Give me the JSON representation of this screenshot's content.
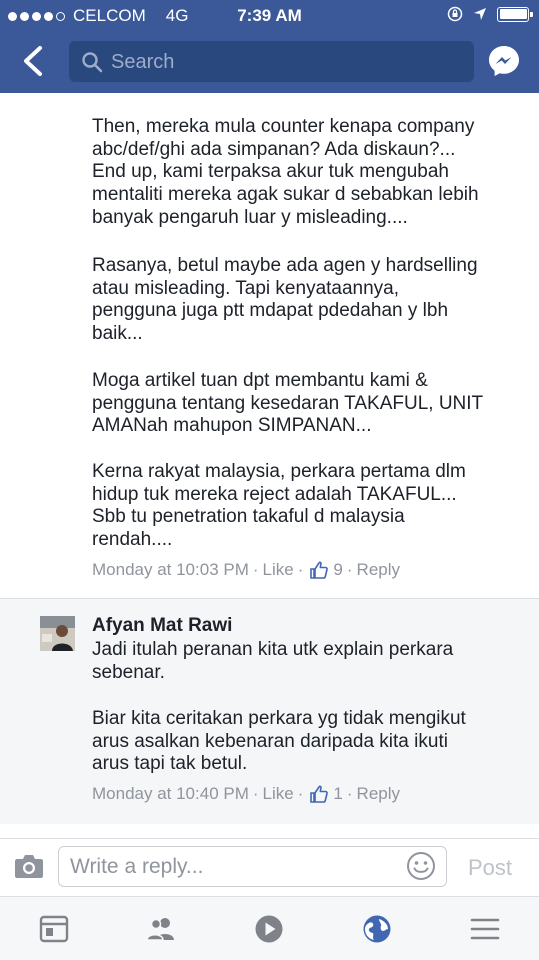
{
  "status_bar": {
    "carrier": "CELCOM",
    "network": "4G",
    "time": "7:39 AM"
  },
  "nav": {
    "search_placeholder": "Search"
  },
  "comments": [
    {
      "paragraphs": [
        "Then, mereka mula counter kenapa company\nabc/def/ghi ada simpanan? Ada diskaun?...\nEnd up, kami terpaksa akur tuk mengubah\nmentaliti mereka agak sukar d sebabkan lebih\nbanyak pengaruh luar y misleading....",
        "Rasanya, betul maybe ada agen y hardselling\natau misleading. Tapi kenyataannya,\npengguna juga ptt mdapat pdedahan y lbh\nbaik...",
        "Moga artikel tuan dpt membantu kami &\npengguna tentang kesedaran TAKAFUL, UNIT\nAMANah mahupon SIMPANAN...",
        "Kerna rakyat malaysia, perkara pertama dlm\nhidup tuk mereka reject adalah TAKAFUL...\nSbb tu penetration takaful d malaysia\nrendah...."
      ],
      "timestamp": "Monday at 10:03 PM",
      "like_label": "Like",
      "like_count": "9",
      "reply_label": "Reply"
    },
    {
      "author": "Afyan Mat Rawi",
      "paragraphs": [
        "Jadi itulah peranan kita utk explain perkara\nsebenar.",
        "Biar  kita ceritakan perkara yg tidak mengikut\narus asalkan kebenaran daripada kita ikuti\narus tapi tak betul."
      ],
      "timestamp": "Monday at 10:40 PM",
      "like_label": "Like",
      "like_count": "1",
      "reply_label": "Reply"
    }
  ],
  "composer": {
    "placeholder": "Write a reply...",
    "post_label": "Post"
  },
  "tabbar": {
    "icons": [
      "news-feed-icon",
      "friends-icon",
      "video-icon",
      "notifications-globe-icon",
      "menu-icon"
    ]
  },
  "colors": {
    "brand": "#3b5998",
    "search_bg": "#29487d",
    "meta": "#90949c",
    "active_tab": "#4267b2"
  }
}
